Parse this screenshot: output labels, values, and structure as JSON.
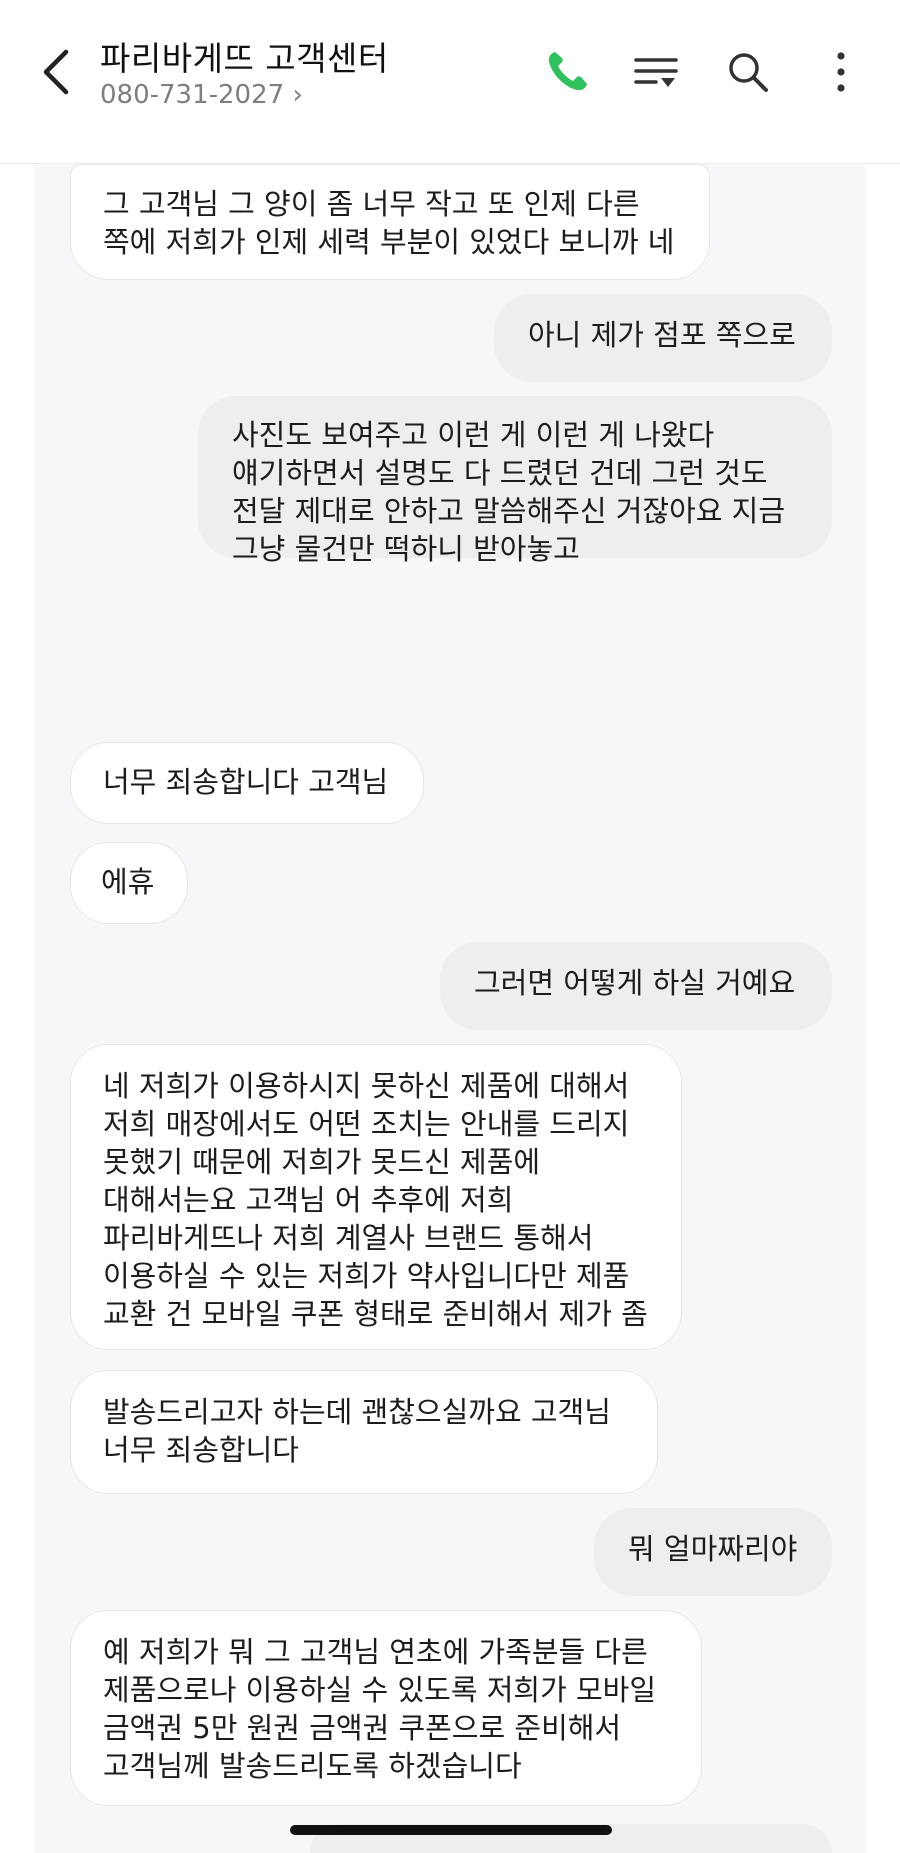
{
  "header": {
    "title": "파리바게뜨 고객센터",
    "phone": "080-731-2027 ›",
    "icons": [
      "chevron-left-icon",
      "phone-icon",
      "filter-list-icon",
      "search-icon",
      "more-vertical-icon"
    ],
    "phone_icon_color": "#2fc15b"
  },
  "messages": [
    {
      "side": "in",
      "text": "그 고객님 그 양이 좀 너무 작고 또 인제 다른\n쪽에 저희가 인제 세력 부분이 있었다 보니까 네"
    },
    {
      "side": "out",
      "text": "아니 제가 점포 쪽으로"
    },
    {
      "side": "out",
      "text": "사진도 보여주고 이런 게 이런 게 나왔다\n얘기하면서 설명도 다 드렸던 건데 그런 것도\n전달 제대로 안하고 말씀해주신 거잖아요 지금\n그냥 물건만 떡하니 받아놓고"
    },
    {
      "side": "in",
      "text": "너무 죄송합니다 고객님"
    },
    {
      "side": "in",
      "text": "에휴"
    },
    {
      "side": "out",
      "text": "그러면 어떻게 하실 거예요"
    },
    {
      "side": "in",
      "text": "네 저희가 이용하시지 못하신 제품에 대해서\n저희 매장에서도 어떤 조치는 안내를 드리지\n못했기 때문에 저희가 못드신 제품에\n대해서는요 고객님 어 추후에 저희\n파리바게뜨나 저희 계열사 브랜드 통해서\n이용하실 수 있는 저희가 약사입니다만 제품\n교환 건 모바일 쿠폰 형태로 준비해서 제가 좀"
    },
    {
      "side": "in",
      "text": "발송드리고자 하는데 괜찮으실까요 고객님\n너무 죄송합니다"
    },
    {
      "side": "out",
      "text": "뭐 얼마짜리야"
    },
    {
      "side": "in",
      "text": "예 저희가 뭐 그 고객님 연초에 가족분들 다른\n제품으로나 이용하실 수 있도록 저희가 모바일\n금액권 5만 원권 금액권 쿠폰으로 준비해서\n고객님께 발송드리도록 하겠습니다"
    }
  ],
  "colors": {
    "incoming_bg": "#ffffff",
    "outgoing_bg": "#eeeef1",
    "chat_bg": "#f7f7f9"
  }
}
